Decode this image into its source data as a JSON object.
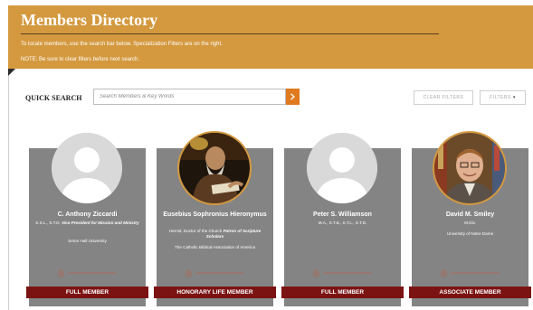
{
  "header": {
    "title": "Members Directory",
    "line1": "To locate members, use the search bar below.  Specialization Filters are on the right.",
    "line2": "NOTE: Be sure to clear filters before next search."
  },
  "search": {
    "label": "QUICK SEARCH",
    "placeholder": "Search Members & Key Words",
    "value": "",
    "go_icon": "chevron-right-icon"
  },
  "toolbar": {
    "clear_label": "CLEAR FILTERS",
    "filters_label": "FILTERS",
    "filters_caret": "▾"
  },
  "colors": {
    "header_bg": "#d4993f",
    "accent_orange": "#e07a1f",
    "card_bg": "#848484",
    "ribbon_bg": "#7b1313"
  },
  "members": [
    {
      "name": "C. Anthony Ziccardi",
      "credentials": "S.S.L., S.T.D.",
      "role": "Vice President for Mission and Ministry",
      "institution": "Seton Hall University",
      "membership": "FULL MEMBER",
      "avatar": "placeholder"
    },
    {
      "name": "Eusebius Sophronius Hieronymus",
      "credentials": "Hermit, Doctor of the Church",
      "role": "Patron of Scripture Scholars",
      "institution": "The Catholic Biblical Association of America",
      "membership": "HONORARY LIFE MEMBER",
      "avatar": "painting"
    },
    {
      "name": "Peter S. Williamson",
      "credentials": "M.A., S.T.B., S.T.L., S.T.D.",
      "role": "",
      "institution": "",
      "membership": "FULL MEMBER",
      "avatar": "placeholder"
    },
    {
      "name": "David M. Smiley",
      "credentials": "M.Div.",
      "role": "",
      "institution": "University of Notre Dame",
      "membership": "ASSOCIATE MEMBER",
      "avatar": "photo"
    }
  ]
}
